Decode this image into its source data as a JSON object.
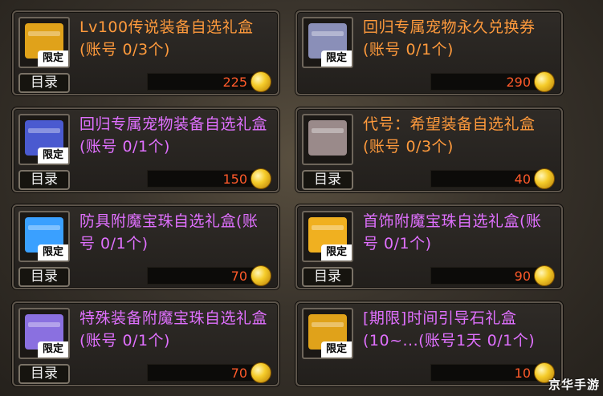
{
  "catalog_label": "目录",
  "limited_tag": "限定",
  "items": [
    {
      "title": "Lv100传说装备自选礼盒(账号 0/3个)",
      "price": "225",
      "title_color": "#ff9a3c",
      "box_color": "#e0a21a"
    },
    {
      "title": "回归专属宠物永久兑换券(账号 0/1个)",
      "price": "290",
      "title_color": "#ff9a3c",
      "box_color": "#8a8fb8"
    },
    {
      "title": "回归专属宠物装备自选礼盒(账号 0/1个)",
      "price": "150",
      "title_color": "#e070ff",
      "box_color": "#4a5ad0"
    },
    {
      "title": "代号：希望装备自选礼盒(账号 0/3个)",
      "price": "40",
      "title_color": "#ff9a3c",
      "box_color": "#9a8a8a"
    },
    {
      "title": "防具附魔宝珠自选礼盒(账号 0/1个)",
      "price": "70",
      "title_color": "#e070ff",
      "box_color": "#3aa0ff"
    },
    {
      "title": "首饰附魔宝珠自选礼盒(账号 0/1个)",
      "price": "90",
      "title_color": "#e070ff",
      "box_color": "#f0b020"
    },
    {
      "title": "特殊装备附魔宝珠自选礼盒(账号 0/1个)",
      "price": "70",
      "title_color": "#e070ff",
      "box_color": "#8a70e0"
    },
    {
      "title": "[期限]时间引导石礼盒(10~...(账号1天 0/1个)",
      "price": "10",
      "title_color": "#e070ff",
      "box_color": "#e0a21a"
    }
  ],
  "watermark": "京华手游"
}
